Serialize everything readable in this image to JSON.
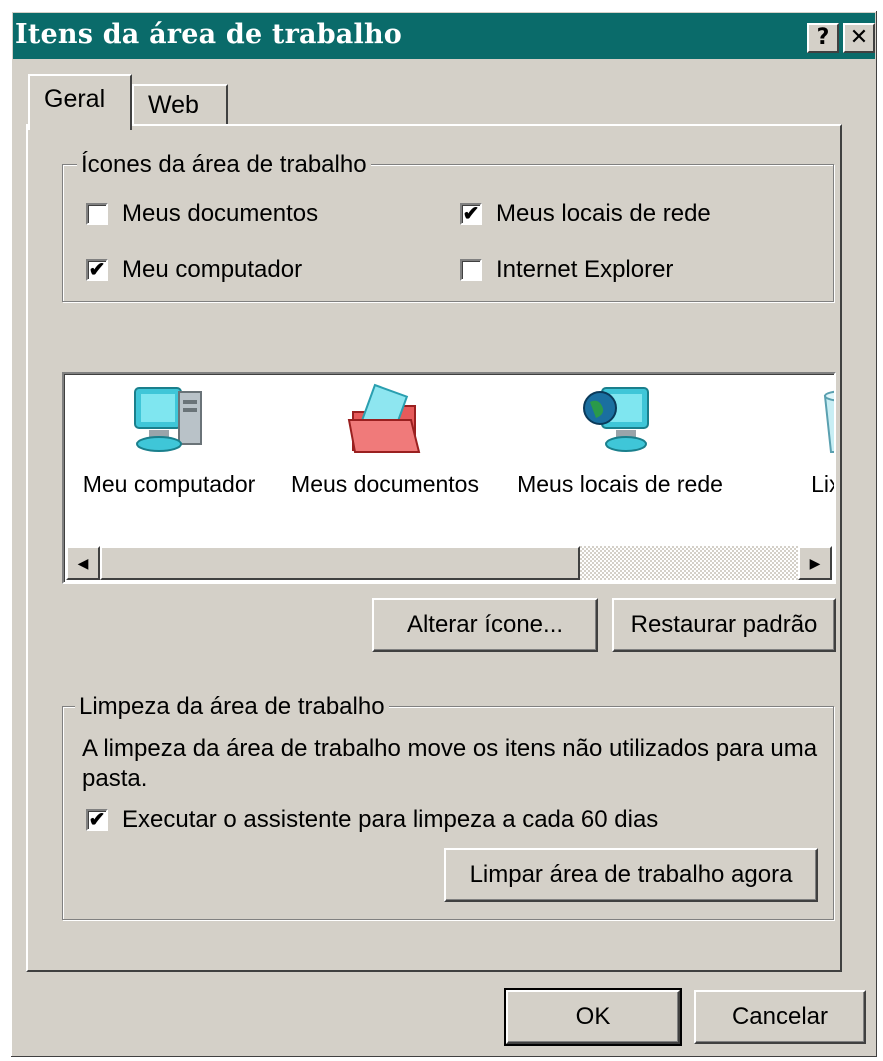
{
  "window": {
    "title": "Itens da área de trabalho",
    "help_label": "?",
    "close_label": "✕"
  },
  "tabs": [
    {
      "label": "Geral"
    },
    {
      "label": "Web"
    }
  ],
  "icons_group": {
    "label": "Ícones da área de trabalho",
    "checkboxes": [
      {
        "label": "Meus documentos",
        "checked": false
      },
      {
        "label": "Meus locais de rede",
        "checked": true
      },
      {
        "label": "Meu computador",
        "checked": true
      },
      {
        "label": "Internet Explorer",
        "checked": false
      }
    ]
  },
  "icon_list": {
    "items": [
      {
        "label": "Meu computador",
        "icon": "computer-icon"
      },
      {
        "label": "Meus documentos",
        "icon": "documents-folder-icon"
      },
      {
        "label": "Meus locais de rede",
        "icon": "network-places-icon"
      },
      {
        "label": "Lixeira",
        "icon": "recycle-bin-icon"
      }
    ]
  },
  "buttons": {
    "change_icon": "Alterar ícone...",
    "restore_default": "Restaurar padrão",
    "clean_now": "Limpar área de trabalho agora",
    "ok": "OK",
    "cancel": "Cancelar"
  },
  "cleanup_group": {
    "label": "Limpeza da área de trabalho",
    "description": "A limpeza da área de trabalho move os itens não utilizados para uma pasta.",
    "checkbox": {
      "label": "Executar o assistente para limpeza a cada 60 dias",
      "checked": true
    }
  },
  "colors": {
    "titlebar": "#0a6b6a",
    "face": "#d4d0c8"
  }
}
